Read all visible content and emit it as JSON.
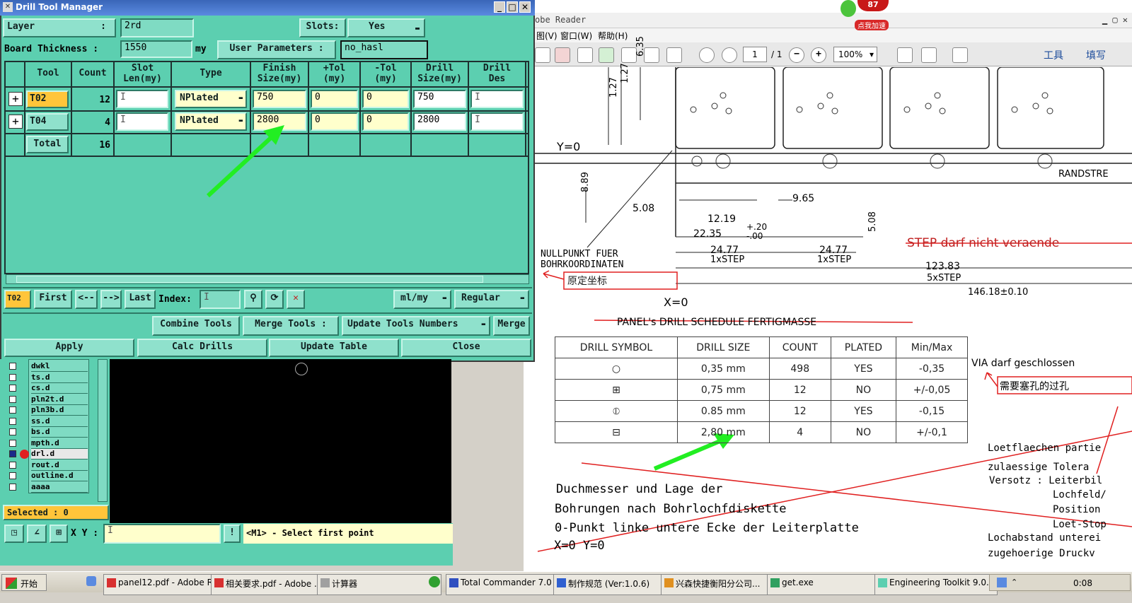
{
  "window": {
    "title": "Drill Tool Manager"
  },
  "form": {
    "layer_label": "Layer",
    "layer_colon": ":",
    "layer_value": "2rd",
    "slots_label": "Slots:",
    "slots_value": "Yes",
    "thickness_label": "Board Thickness :",
    "thickness_value": "1550",
    "thickness_unit": "my",
    "user_params_label": "User Parameters :",
    "user_params_value": "no_hasl"
  },
  "table": {
    "headers": [
      "Tool",
      "Count",
      "Slot\nLen(my)",
      "Type",
      "Finish\nSize(my)",
      "+Tol\n(my)",
      "-Tol\n(my)",
      "Drill\nSize(my)",
      "Drill\nDes"
    ],
    "rows": [
      {
        "tool": "T02",
        "count": "12",
        "type": "NPlated",
        "finish": "750",
        "ptol": "0",
        "ntol": "0",
        "drill": "750"
      },
      {
        "tool": "T04",
        "count": "4",
        "type": "NPlated",
        "finish": "2800",
        "ptol": "0",
        "ntol": "0",
        "drill": "2800"
      }
    ],
    "total_label": "Total",
    "total_count": "16"
  },
  "nav": {
    "current": "T02",
    "first": "First",
    "prev": "<--",
    "next": "-->",
    "last": "Last",
    "index_label": "Index:",
    "units": "ml/my",
    "mode": "Regular"
  },
  "actions": {
    "combine": "Combine Tools",
    "merge_tools": "Merge Tools :",
    "update_numbers": "Update Tools Numbers",
    "merge": "Merge",
    "apply": "Apply",
    "calc": "Calc Drills",
    "update_table": "Update Table",
    "close": "Close"
  },
  "layers": [
    "dwkl",
    "ts.d",
    "cs.d",
    "pln2t.d",
    "pln3b.d",
    "ss.d",
    "bs.d",
    "mpth.d",
    "drl.d",
    "rout.d",
    "outline.d",
    "aaaa"
  ],
  "selected": "Selected : 0",
  "xy_label": "X Y :",
  "prompt": "<M1> - Select first point",
  "pdf": {
    "title": "obe Reader",
    "menu": [
      "图(V)",
      "窗口(W)",
      "帮助(H)"
    ],
    "page_current": "1",
    "page_total": "/ 1",
    "zoom": "100%",
    "tools_label": "工具",
    "sign_label": "填写",
    "badge_count": "87",
    "badge_label": "点我加速"
  },
  "drawing": {
    "y0": "Y=0",
    "x0": "X=0",
    "nullpunkt": "NULLPUNKT FUER",
    "bohrkoord": "BOHRKOORDINATEN",
    "note_origin": "原定坐标",
    "dims": [
      "1.27",
      "1.27",
      "6.35",
      "8.89",
      "5.08",
      "12.19",
      "+.20",
      "-.00",
      "22.35",
      "9.65",
      "5.08",
      "24.77",
      "1xSTEP",
      "24.77",
      "1xSTEP",
      "123.83",
      "5xSTEP",
      "146.18±0.10"
    ],
    "randstreifen": "RANDSTRE",
    "step_note": "STEP darf nicht veraende",
    "schedule_title": "PANEL's DRILL SCHEDULE    FERTIGMASSE",
    "schedule_headers": [
      "DRILL SYMBOL",
      "DRILL SIZE",
      "COUNT",
      "PLATED",
      "Min/Max"
    ],
    "schedule_rows": [
      {
        "symbol": "○",
        "size": "0,35 mm",
        "count": "498",
        "plated": "YES",
        "minmax": "-0,35"
      },
      {
        "symbol": "⊞",
        "size": "0,75 mm",
        "count": "12",
        "plated": "NO",
        "minmax": "+/-0,05"
      },
      {
        "symbol": "⦶",
        "size": "0.85 mm",
        "count": "12",
        "plated": "YES",
        "minmax": "-0,15"
      },
      {
        "symbol": "⊟",
        "size": "2,80 mm",
        "count": "4",
        "plated": "NO",
        "minmax": "+/-0,1"
      }
    ],
    "via_note": "VIA  darf geschlossen",
    "via_cn": "需要塞孔的过孔",
    "right_notes": [
      "Loetflaechen partie",
      "zulaessige Tolera",
      "Versotz : Leiterbil",
      "Lochfeld/",
      "Position",
      "Loet-Stop",
      "Lochabstand unterei",
      "zugehoerige Druckv"
    ],
    "bottom_notes": [
      "Duchmesser und Lage der",
      "Bohrungen nach Bohrlochfdiskette",
      "0-Punkt linke untere Ecke der Leiterplatte",
      "X=0  Y=0"
    ]
  },
  "taskbar": {
    "start": "开始",
    "tasks": [
      "panel12.pdf - Adobe R...",
      "相关要求.pdf - Adobe ...",
      "计算器",
      "Total Commander 7.0 p...",
      "制作规范 (Ver:1.0.6)",
      "兴森快捷衡阳分公司...",
      "get.exe",
      "Engineering Toolkit 9.0..."
    ],
    "clock": "0:08"
  },
  "colors": {
    "panel": "#5ccfb0",
    "button": "#8fe1cc",
    "field_yellow": "#ffffcc",
    "tool_orange": "#ffc53a",
    "arrow_green": "#22ee22",
    "annot_red": "#e02020"
  }
}
